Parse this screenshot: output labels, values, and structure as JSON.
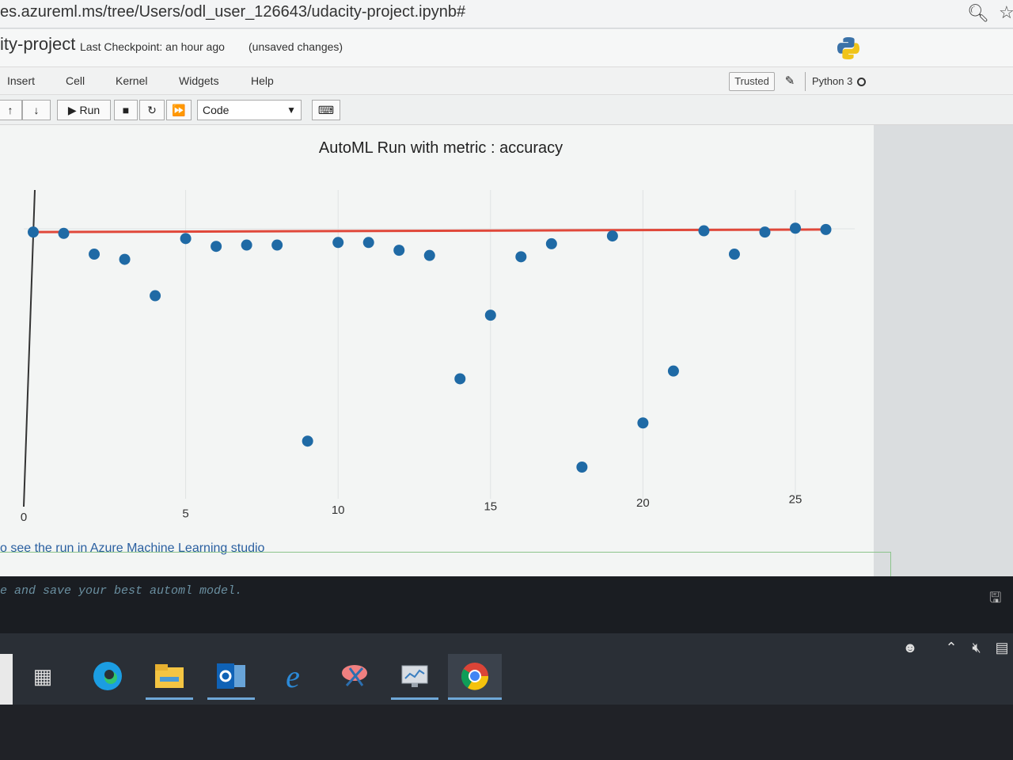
{
  "browser": {
    "url": "es.azureml.ms/tree/Users/odl_user_126643/udacity-project.ipynb#"
  },
  "notebook": {
    "name": "ity-project",
    "checkpoint": "Last Checkpoint: an hour ago",
    "unsaved": "(unsaved changes)"
  },
  "menu": {
    "items": [
      "Insert",
      "Cell",
      "Kernel",
      "Widgets",
      "Help"
    ],
    "trusted": "Trusted",
    "kernel": "Python 3"
  },
  "toolbar": {
    "run_label": "Run",
    "cell_type": "Code"
  },
  "output": {
    "link_text": "o see the run in Azure Machine Learning studio",
    "code_comment": "e and save your best automl model."
  },
  "chart_data": {
    "type": "scatter",
    "title": "AutoML Run with metric : accuracy",
    "xlabel": "",
    "ylabel": "",
    "xticks": [
      0,
      5,
      10,
      15,
      20,
      25
    ],
    "xlim": [
      0,
      25
    ],
    "ylim": [
      0,
      1
    ],
    "grid": true,
    "points": [
      {
        "x": 0,
        "y": 0.905
      },
      {
        "x": 1,
        "y": 0.9
      },
      {
        "x": 2,
        "y": 0.82
      },
      {
        "x": 3,
        "y": 0.8
      },
      {
        "x": 4,
        "y": 0.66
      },
      {
        "x": 5,
        "y": 0.88
      },
      {
        "x": 6,
        "y": 0.85
      },
      {
        "x": 7,
        "y": 0.855
      },
      {
        "x": 8,
        "y": 0.855
      },
      {
        "x": 9,
        "y": 0.1
      },
      {
        "x": 10,
        "y": 0.865
      },
      {
        "x": 11,
        "y": 0.865
      },
      {
        "x": 12,
        "y": 0.835
      },
      {
        "x": 13,
        "y": 0.815
      },
      {
        "x": 14,
        "y": 0.34
      },
      {
        "x": 15,
        "y": 0.585
      },
      {
        "x": 16,
        "y": 0.81
      },
      {
        "x": 17,
        "y": 0.86
      },
      {
        "x": 18,
        "y": 0.0
      },
      {
        "x": 19,
        "y": 0.89
      },
      {
        "x": 20,
        "y": 0.17
      },
      {
        "x": 21,
        "y": 0.37
      },
      {
        "x": 22,
        "y": 0.91
      },
      {
        "x": 23,
        "y": 0.82
      },
      {
        "x": 24,
        "y": 0.905
      },
      {
        "x": 25,
        "y": 0.92
      },
      {
        "x": 26,
        "y": 0.915
      }
    ],
    "best_line": {
      "x": [
        0,
        26
      ],
      "y": [
        0.905,
        0.915
      ]
    },
    "colors": {
      "points": "#1f6aa5",
      "best_line": "#e0483a"
    }
  },
  "taskbar": {
    "apps": [
      {
        "icon": "task-view-icon"
      },
      {
        "icon": "edge-icon"
      },
      {
        "icon": "file-explorer-icon"
      },
      {
        "icon": "outlook-icon"
      },
      {
        "icon": "internet-explorer-icon"
      },
      {
        "icon": "snipping-tool-icon"
      },
      {
        "icon": "remote-desktop-icon"
      },
      {
        "icon": "chrome-icon"
      }
    ],
    "tray": [
      "people-icon",
      "chevron-up-icon",
      "volume-muted-icon",
      "network-icon"
    ]
  }
}
